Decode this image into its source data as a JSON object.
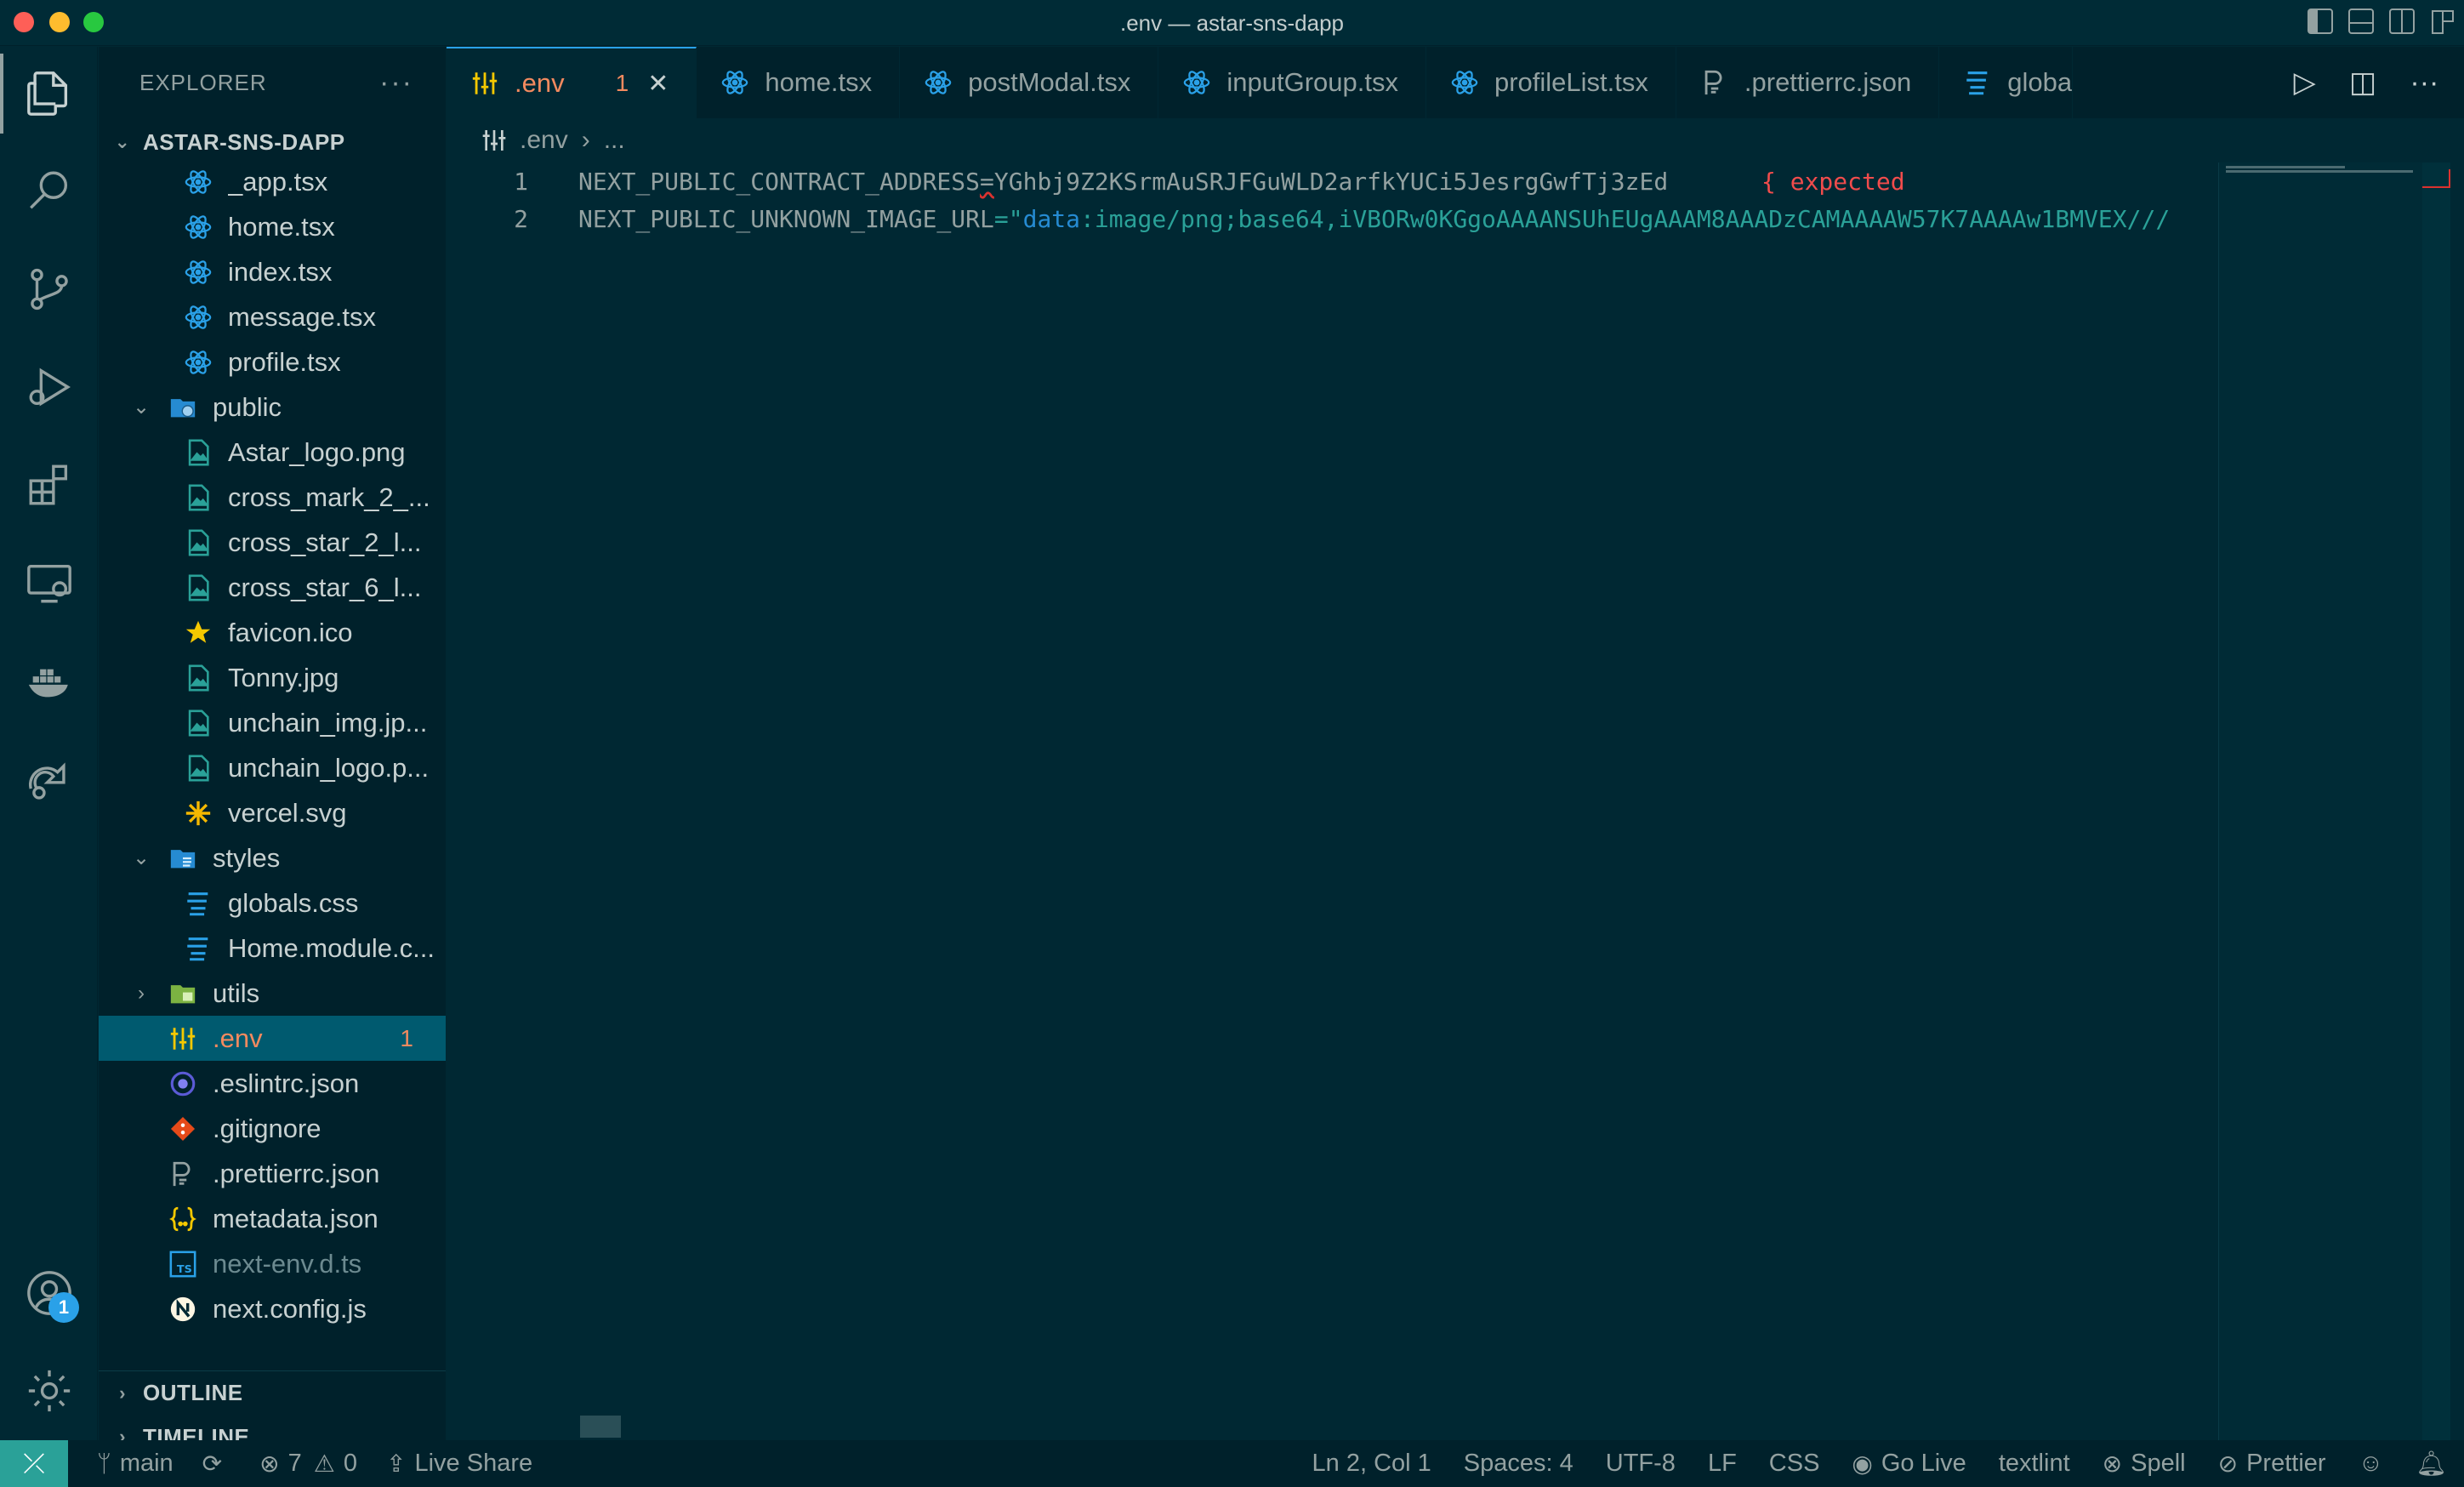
{
  "window": {
    "title": ".env — astar-sns-dapp"
  },
  "activity_bar": {
    "items": [
      "explorer-icon",
      "search-icon",
      "source-control-icon",
      "run-debug-icon",
      "extensions-icon",
      "remote-explorer-icon",
      "docker-icon",
      "live-share-icon"
    ],
    "accounts_badge": "1"
  },
  "sidebar": {
    "header": "EXPLORER",
    "more": "···",
    "project": "ASTAR-SNS-DAPP",
    "tree": [
      {
        "label": "_app.tsx",
        "icon": "react-icon",
        "depth": 2
      },
      {
        "label": "home.tsx",
        "icon": "react-icon",
        "depth": 2
      },
      {
        "label": "index.tsx",
        "icon": "react-icon",
        "depth": 2
      },
      {
        "label": "message.tsx",
        "icon": "react-icon",
        "depth": 2
      },
      {
        "label": "profile.tsx",
        "icon": "react-icon",
        "depth": 2
      },
      {
        "label": "public",
        "icon": "folder-public-icon",
        "depth": 1,
        "expanded": true
      },
      {
        "label": "Astar_logo.png",
        "icon": "image-icon",
        "depth": 2
      },
      {
        "label": "cross_mark_2_...",
        "icon": "image-icon",
        "depth": 2
      },
      {
        "label": "cross_star_2_l...",
        "icon": "image-icon",
        "depth": 2
      },
      {
        "label": "cross_star_6_l...",
        "icon": "image-icon",
        "depth": 2
      },
      {
        "label": "favicon.ico",
        "icon": "star-icon",
        "depth": 2
      },
      {
        "label": "Tonny.jpg",
        "icon": "image-icon",
        "depth": 2
      },
      {
        "label": "unchain_img.jp...",
        "icon": "image-icon",
        "depth": 2
      },
      {
        "label": "unchain_logo.p...",
        "icon": "image-icon",
        "depth": 2
      },
      {
        "label": "vercel.svg",
        "icon": "svg-icon",
        "depth": 2
      },
      {
        "label": "styles",
        "icon": "folder-styles-icon",
        "depth": 1,
        "expanded": true
      },
      {
        "label": "globals.css",
        "icon": "css-icon",
        "depth": 2
      },
      {
        "label": "Home.module.c...",
        "icon": "css-icon",
        "depth": 2
      },
      {
        "label": "utils",
        "icon": "folder-utils-icon",
        "depth": 1,
        "expanded": false
      },
      {
        "label": ".env",
        "icon": "env-icon",
        "depth": 1,
        "selected": true,
        "count": "1"
      },
      {
        "label": ".eslintrc.json",
        "icon": "eslint-icon",
        "depth": 1
      },
      {
        "label": ".gitignore",
        "icon": "git-icon",
        "depth": 1
      },
      {
        "label": ".prettierrc.json",
        "icon": "prettier-icon",
        "depth": 1
      },
      {
        "label": "metadata.json",
        "icon": "json-icon",
        "depth": 1
      },
      {
        "label": "next-env.d.ts",
        "icon": "ts-icon",
        "depth": 1,
        "dim": true
      },
      {
        "label": "next.config.js",
        "icon": "next-icon",
        "depth": 1
      }
    ],
    "outline": "OUTLINE",
    "timeline": "TIMELINE"
  },
  "tabs": [
    {
      "label": ".env",
      "icon": "env-icon",
      "active": true,
      "problems": "1",
      "close": "✕"
    },
    {
      "label": "home.tsx",
      "icon": "react-icon"
    },
    {
      "label": "postModal.tsx",
      "icon": "react-icon"
    },
    {
      "label": "inputGroup.tsx",
      "icon": "react-icon"
    },
    {
      "label": "profileList.tsx",
      "icon": "react-icon"
    },
    {
      "label": ".prettierrc.json",
      "icon": "prettier-icon"
    },
    {
      "label": "globa",
      "icon": "css-icon"
    }
  ],
  "breadcrumb": {
    "file": ".env",
    "sep": "›",
    "more": "..."
  },
  "editor": {
    "lines": [
      {
        "num": "1",
        "key": "NEXT_PUBLIC_CONTRACT_ADDRESS",
        "eq": "=",
        "value": "YGhbj9Z2KSrmAuSRJFGuWLD2arfkYUCi5JesrgGwfTj3zEd"
      },
      {
        "num": "2",
        "key": "NEXT_PUBLIC_UNKNOWN_IMAGE_URL",
        "eq": "=\"",
        "value_kw": "data",
        "value": ":image/png;base64,iVBORw0KGgoAAAANSUhEUgAAAM8AAADzCAMAAAAW57K7AAAAw1BMVEX///"
      }
    ],
    "inline_error": "{ expected"
  },
  "statusbar": {
    "branch": "main",
    "errors": "7",
    "warnings": "0",
    "live_share": "Live Share",
    "position": "Ln 2, Col 1",
    "spaces": "Spaces: 4",
    "encoding": "UTF-8",
    "eol": "LF",
    "language": "CSS",
    "go_live": "Go Live",
    "textlint": "textlint",
    "spell": "Spell",
    "prettier": "Prettier"
  },
  "colors": {
    "accent": "#2aa1e8",
    "error": "#f14c4c",
    "modified": "#f38a5f",
    "remote": "#2aa198"
  }
}
